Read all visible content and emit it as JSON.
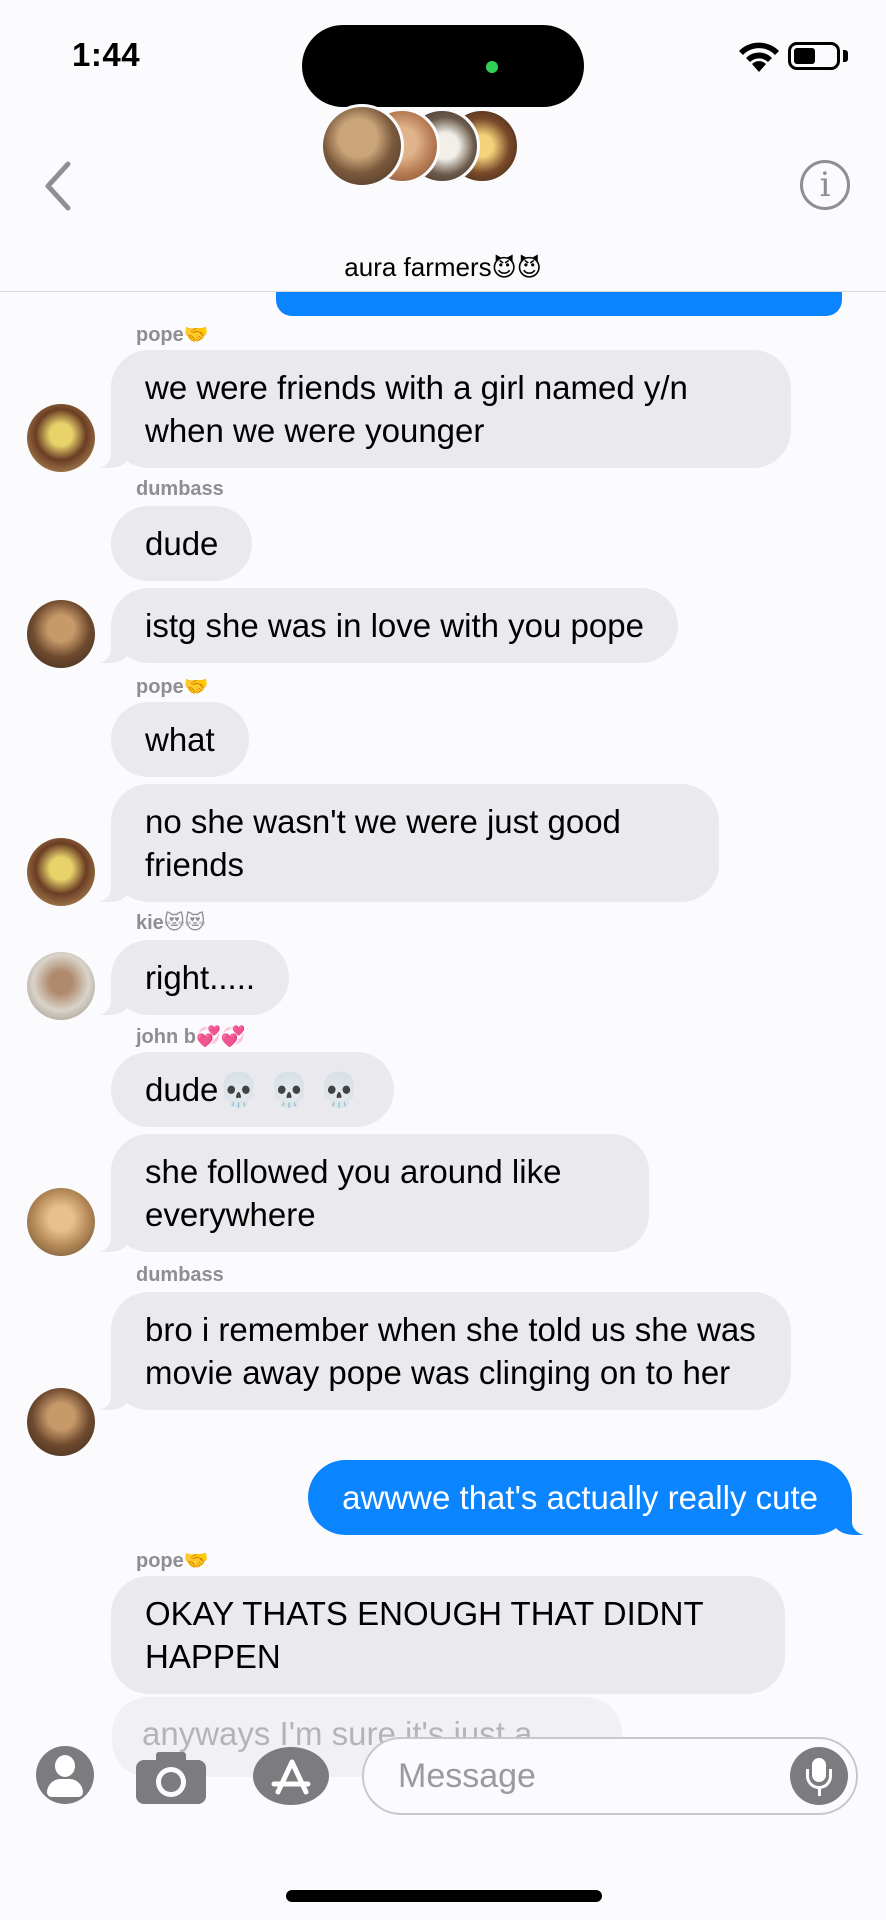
{
  "status_bar": {
    "time": "1:44"
  },
  "header": {
    "group_name": "aura farmers",
    "group_emoji": "😈😈",
    "info_label": "i"
  },
  "messages": [
    {
      "sender": "pope",
      "sender_emoji": "🤝",
      "text": "we were friends with a girl named y/n when we were younger",
      "from_me": false
    },
    {
      "sender": "dumbass",
      "sender_emoji": "",
      "text": "dude",
      "from_me": false
    },
    {
      "sender": "",
      "text": "istg she was in love with you pope",
      "from_me": false
    },
    {
      "sender": "pope",
      "sender_emoji": "🤝",
      "text": "what",
      "from_me": false
    },
    {
      "sender": "",
      "text": "no she wasn't we were just good friends",
      "from_me": false
    },
    {
      "sender": "kie",
      "sender_emoji": "😻😻",
      "text": "right.....",
      "from_me": false
    },
    {
      "sender": "john b",
      "sender_emoji": "💞💞",
      "text": "dude💀 💀 💀",
      "from_me": false
    },
    {
      "sender": "",
      "text": "she followed you around like everywhere",
      "from_me": false
    },
    {
      "sender": "dumbass",
      "sender_emoji": "",
      "text": "bro i remember when she told us she was movie away pope was clinging on to her",
      "from_me": false
    },
    {
      "sender": "me",
      "text": "awwwe that's actually really cute",
      "from_me": true
    },
    {
      "sender": "pope",
      "sender_emoji": "🤝",
      "text": "OKAY THATS ENOUGH THAT DIDNT HAPPEN",
      "from_me": false
    },
    {
      "sender": "",
      "text": "anyways I'm sure it's just a",
      "from_me": false
    }
  ],
  "composer": {
    "placeholder": "Message"
  },
  "colors": {
    "sent_bubble": "#0a84ff",
    "received_bubble": "#e9e9ee",
    "background": "#fbfbfd"
  }
}
